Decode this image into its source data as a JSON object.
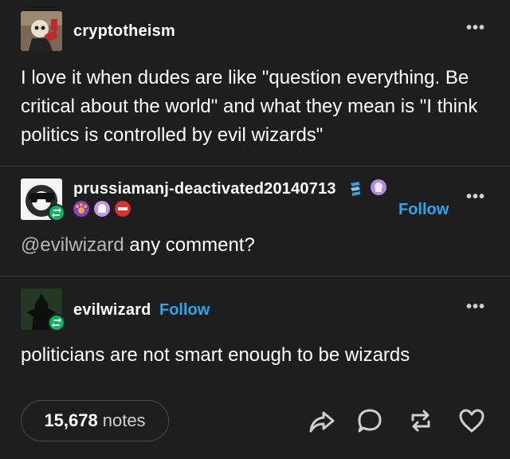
{
  "posts": [
    {
      "username": "cryptotheism",
      "body": "I love it when dudes are like \"question everything. Be critical about the world\" and what they mean is \"I think politics is controlled by evil wizards\"",
      "more": "•••"
    },
    {
      "username": "prussiamanj-deactivated20140713",
      "mention": "@evilwizard",
      "body_rest": " any comment?",
      "follow": "Follow",
      "more": "•••"
    },
    {
      "username": "evilwizard",
      "body": "politicians are not smart enough to be wizards",
      "follow": "Follow",
      "more": "•••"
    }
  ],
  "footer": {
    "notes_count": "15,678",
    "notes_label": "notes"
  },
  "colors": {
    "background": "#1e1e1e",
    "accent_follow": "#2aa7ee",
    "reblog_green": "#00b85c"
  }
}
